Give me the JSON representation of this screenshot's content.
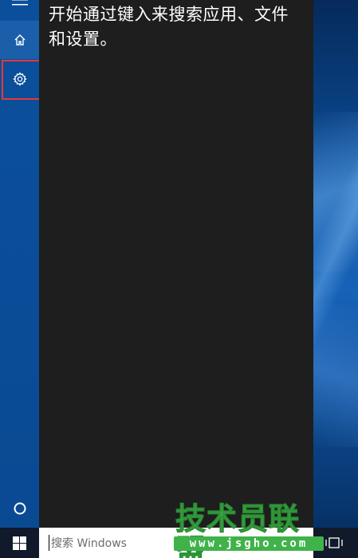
{
  "cortana": {
    "hint_text": "开始通过键入来搜索应用、文件和设置。"
  },
  "taskbar": {
    "search_placeholder": "搜索 Windows"
  },
  "watermark": {
    "title": "技术员联盟",
    "url": "www.jsgho.com"
  },
  "colors": {
    "rail": "#0a4a93",
    "panel": "#1e1e1e",
    "highlight": "#e8373a",
    "watermark_green": "#3fb24a"
  },
  "icons": {
    "menu": "hamburger-icon",
    "home": "home-icon",
    "settings": "gear-icon",
    "cortana": "cortana-circle-icon",
    "start": "windows-logo-icon",
    "task_view": "task-view-icon"
  }
}
